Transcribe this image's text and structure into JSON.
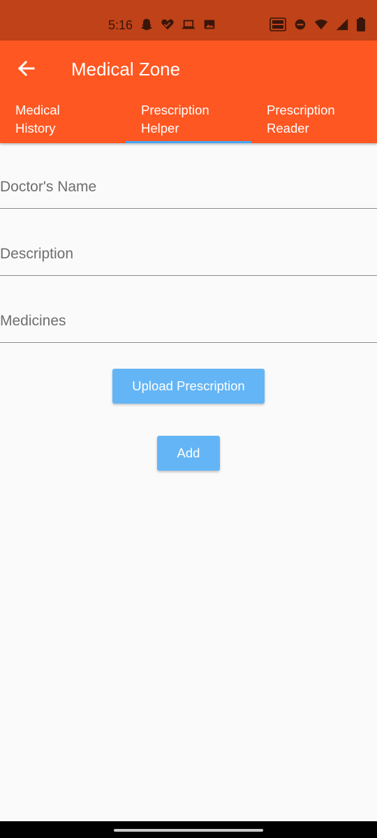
{
  "status_bar": {
    "time": "5:16",
    "left_icons": [
      "snapchat-icon",
      "health-heart-icon",
      "laptop-icon",
      "image-icon"
    ],
    "right_icons": [
      "vowifi-icon",
      "do-not-disturb-icon",
      "wifi-icon",
      "cellular-signal-icon",
      "battery-icon"
    ],
    "background": "#bf4218"
  },
  "app_bar": {
    "title": "Medical Zone",
    "back_icon": "arrow-left-icon",
    "background": "#ff5722"
  },
  "tabs": [
    {
      "label": "Medical History",
      "selected": false
    },
    {
      "label": "Prescription Helper",
      "selected": true
    },
    {
      "label": "Prescription Reader",
      "selected": false
    }
  ],
  "tab_indicator_color": "#42a5f5",
  "form": {
    "doctor_name": {
      "placeholder": "Doctor's Name",
      "value": ""
    },
    "description": {
      "placeholder": "Description",
      "value": ""
    },
    "medicines": {
      "placeholder": "Medicines",
      "value": ""
    }
  },
  "buttons": {
    "upload_label": "Upload Prescription",
    "add_label": "Add",
    "color": "#64b5f6"
  }
}
